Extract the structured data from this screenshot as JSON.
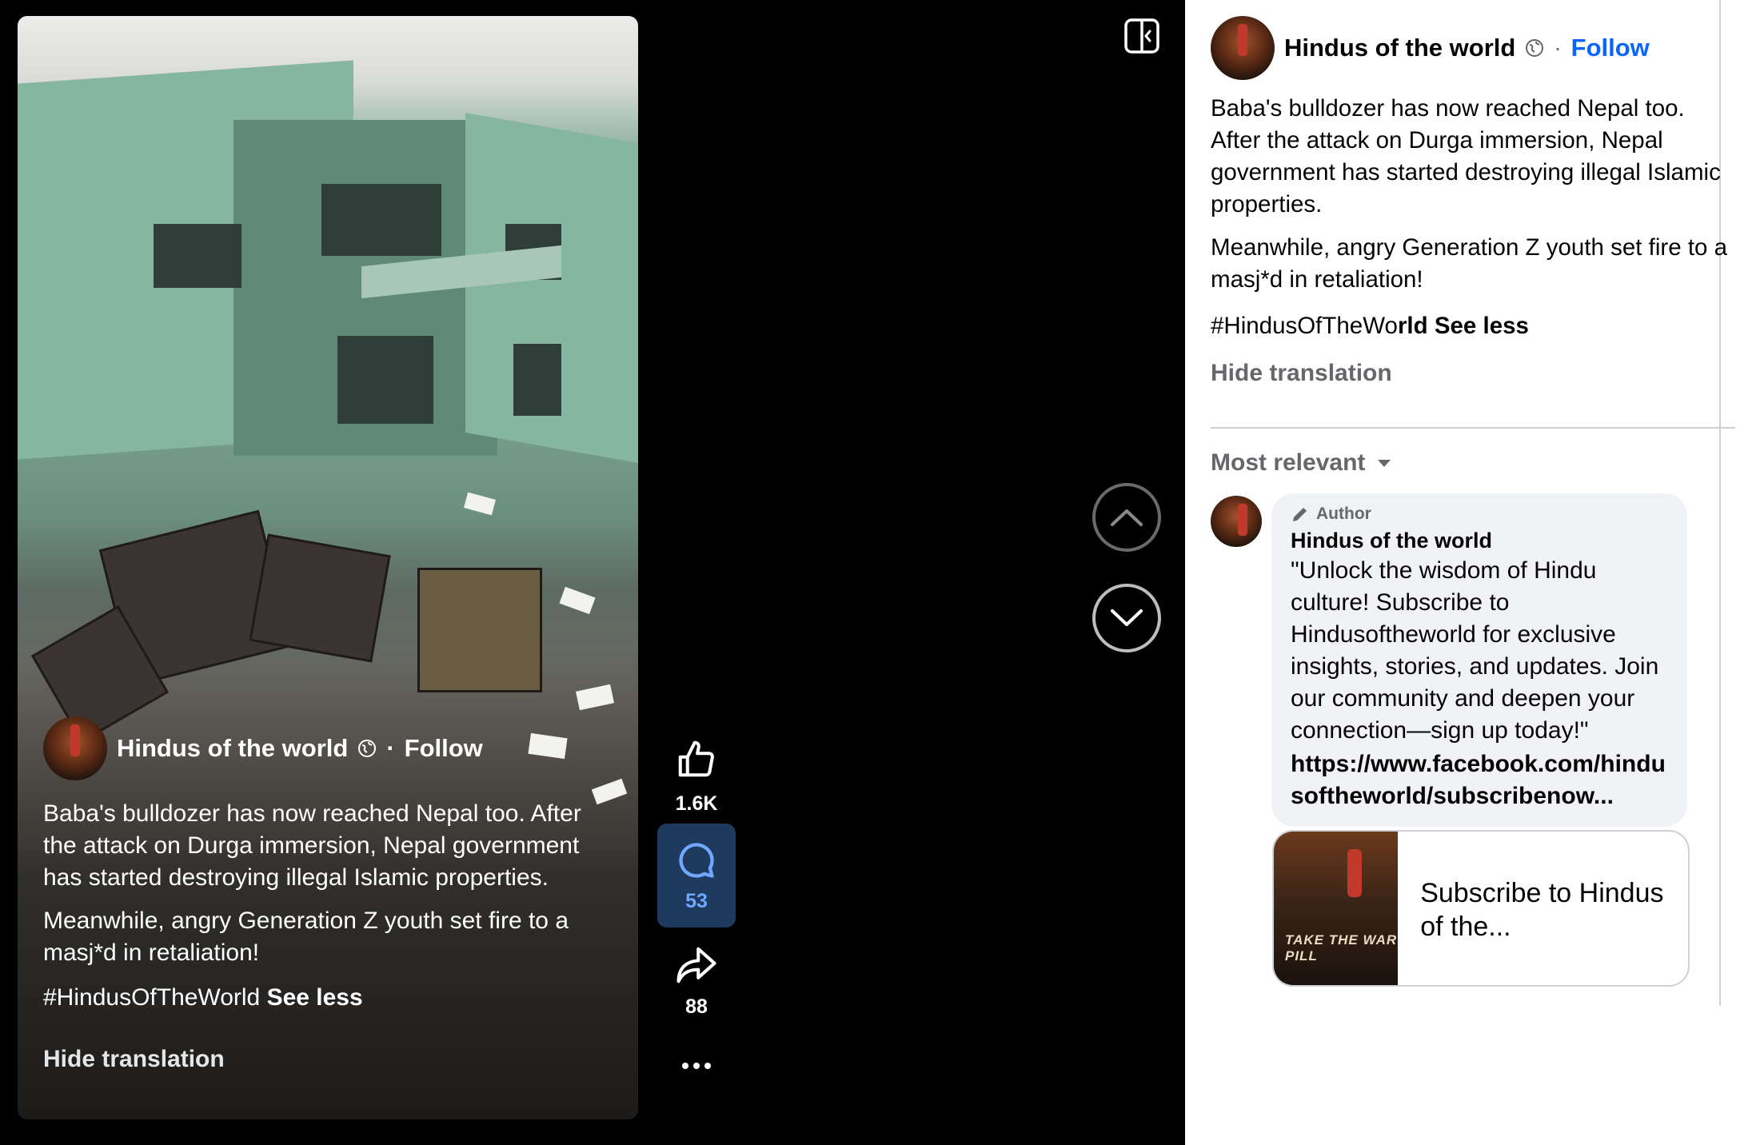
{
  "video": {
    "author_name": "Hindus of the world",
    "follow_label": "Follow",
    "caption_p1": "Baba's bulldozer has now reached Nepal too. After the attack on Durga immersion, Nepal government has started destroying illegal Islamic properties.",
    "caption_p2": "Meanwhile, angry Generation Z youth set fire to a masj*d in retaliation!",
    "hashtag": "#HindusOfTheWorld",
    "see_less": "See less",
    "hide_translation": "Hide translation"
  },
  "actions": {
    "likes": "1.6K",
    "comments": "53",
    "shares": "88"
  },
  "panel": {
    "author_name": "Hindus of the world",
    "separator": "·",
    "follow_label": "Follow",
    "body_p1": "Baba's bulldozer has now reached Nepal too. After the attack on Durga immersion, Nepal government has started destroying illegal Islamic properties.",
    "body_p2": "Meanwhile, angry Generation Z youth set fire to a masj*d in retaliation!",
    "hashtag_plain": "#HindusOfTheWo",
    "hashtag_bold": "rld",
    "see_less": "See less",
    "hide_translation": "Hide translation",
    "sort_label": "Most relevant"
  },
  "comment": {
    "badge": "Author",
    "author_name": "Hindus of the world",
    "text": "\"Unlock the wisdom of Hindu culture! Subscribe to Hindusoftheworld for exclusive insights, stories, and updates. Join our community and deepen your connection—sign up today!\"",
    "link": "https://www.facebook.com/hindusoftheworld/subscribenow...",
    "card_title": "Subscribe to Hindus of the...",
    "card_image_text": "TAKE THE WAR PILL"
  }
}
